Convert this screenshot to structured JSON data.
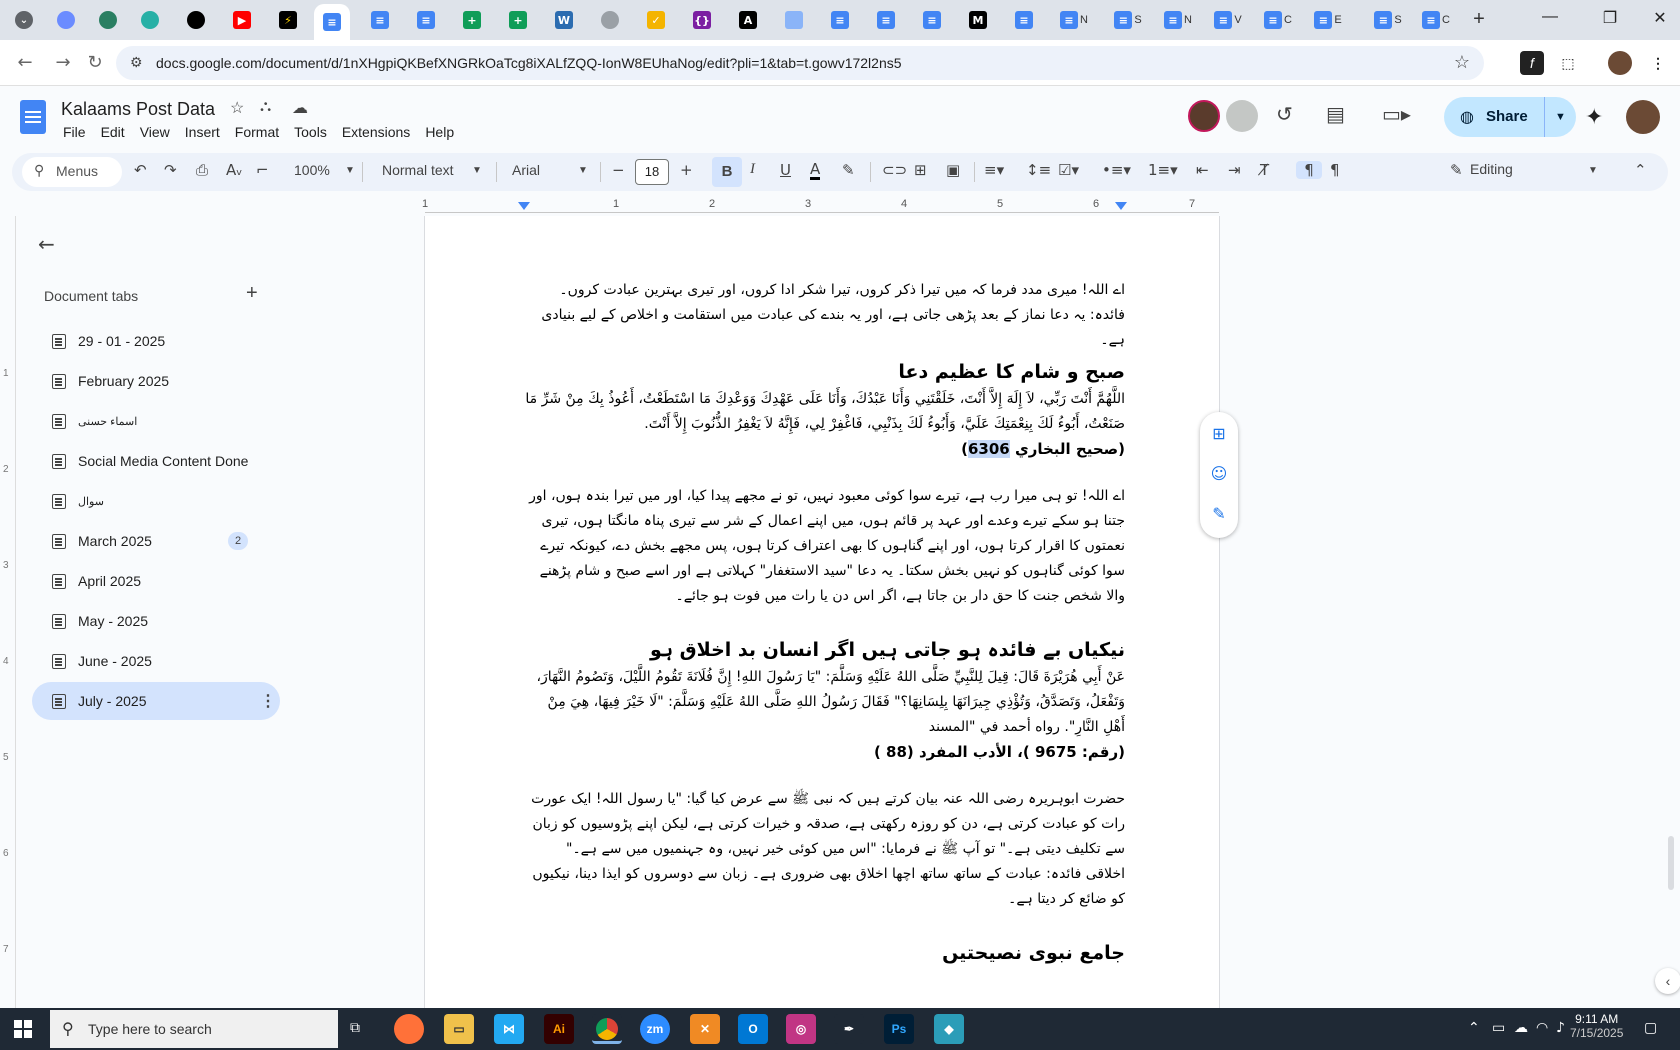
{
  "browser": {
    "url": "docs.google.com/document/d/1nXHgpiQKBefXNGRkOaTcg8iXALfZQQ-IonW8EUhaNog/edit?pli=1&tab=t.gowv172l2ns5",
    "tab_texts": [
      "N",
      "S",
      "N",
      "V",
      "C",
      "E",
      "S",
      "C"
    ],
    "new_tab": "+"
  },
  "docs": {
    "title": "Kalaams Post Data",
    "menu": [
      "File",
      "Edit",
      "View",
      "Insert",
      "Format",
      "Tools",
      "Extensions",
      "Help"
    ],
    "share_label": "Share",
    "toolbar": {
      "menus_label": "Menus",
      "zoom": "100%",
      "style": "Normal text",
      "font": "Arial",
      "font_size": "18",
      "bold": "B",
      "italic": "I",
      "underline": "U",
      "text_color": "A",
      "mode": "Editing"
    },
    "ruler_numbers": [
      "1",
      "1",
      "2",
      "3",
      "4",
      "5",
      "6",
      "7"
    ],
    "vruler_numbers": [
      "1",
      "2",
      "3",
      "4",
      "5",
      "6",
      "7"
    ]
  },
  "sidebar": {
    "heading": "Document tabs",
    "tabs": [
      {
        "label": "29 - 01 - 2025"
      },
      {
        "label": "February 2025"
      },
      {
        "label": "اسماء حسنی"
      },
      {
        "label": "Social Media Content Done"
      },
      {
        "label": "سوال"
      },
      {
        "label": "March 2025",
        "badge": "2"
      },
      {
        "label": "April 2025"
      },
      {
        "label": "May - 2025"
      },
      {
        "label": "June - 2025"
      },
      {
        "label": "July - 2025",
        "selected": true
      }
    ]
  },
  "page": {
    "p1": "اے اللہ! میری مدد فرما کہ میں تیرا ذکر کروں، تیرا شکر ادا کروں، اور تیری بہترین عبادت کروں۔ فائدہ: یہ دعا نماز کے بعد پڑھی جاتی ہے، اور یہ بندے کی عبادت میں استقامت و اخلاص کے لیے بنیادی ہے۔",
    "h1": "صبح و شام کا عظیم دعا",
    "ar1": "اللَّهُمَّ أَنْتَ رَبِّي، لاَ إِلَهَ إِلاَّ أَنْتَ، خَلَقْتَنِي وَأَنَا عَبْدُكَ، وَأَنَا عَلَى عَهْدِكَ وَوَعْدِكَ مَا اسْتَطَعْتُ، أَعُوذُ بِكَ مِنْ شَرِّ مَا صَنَعْتُ، أَبُوءُ لَكَ بِنِعْمَتِكَ عَلَيَّ، وَأَبُوءُ لَكَ بِذَنْبِي، فَاغْفِرْ لِي، فَإِنَّهُ لاَ يَغْفِرُ الذُّنُوبَ إِلاَّ أَنْتَ.",
    "ref1_pre": "(صحيح البخاري ",
    "ref1_num": "6306",
    "ref1_post": ")",
    "p2": "اے اللہ! تو ہی میرا رب ہے، تیرے سوا کوئی معبود نہیں، تو نے مجھے پیدا کیا، اور میں تیرا بندہ ہوں، اور جتنا ہو سکے تیرے وعدے اور عہد پر قائم ہوں، میں اپنے اعمال کے شر سے تیری پناہ مانگتا ہوں، تیری نعمتوں کا اقرار کرتا ہوں، اور اپنے گناہوں کا بھی اعتراف کرتا ہوں، پس مجھے بخش دے، کیونکہ تیرے سوا کوئی گناہوں کو نہیں بخش سکتا۔ یہ دعا \"سید الاستغفار\" کہلاتی ہے اور اسے صبح و شام پڑھنے والا شخص جنت کا حق دار بن جاتا ہے، اگر اس دن یا رات میں فوت ہو جائے۔",
    "h2": "نیکیاں بے فائدہ ہو جاتی ہیں اگر انسان بد اخلاق ہو",
    "ar2": "عَنْ أَبِي هُرَيْرَةَ قَالَ: قِيلَ لِلنَّبِيِّ صَلَّى اللهُ عَلَيْهِ وَسَلَّمَ: \"يَا رَسُولَ اللهِ! إِنَّ فُلَانَةَ تَقُومُ اللَّيْلَ، وَتَصُومُ النَّهَارَ، وَتَفْعَلُ، وَتَصَدَّقُ، وَتُؤْذِي جِيرَانَهَا بِلِسَانِهَا؟\" فَقَالَ رَسُولُ اللهِ صَلَّى اللهُ عَلَيْهِ وَسَلَّمَ: \"لَا خَيْرَ فِيهَا، هِيَ مِنْ أَهْلِ النَّارِ\". رواه أحمد في \"المسند",
    "ref2": "(رقم: 9675 )، الأدب المفرد (88 )",
    "p3": "حضرت ابوہریرہ رضی اللہ عنہ بیان کرتے ہیں کہ نبی ﷺ سے عرض کیا گیا: \"یا رسول اللہ! ایک عورت رات کو عبادت کرتی ہے، دن کو روزہ رکھتی ہے، صدقہ و خیرات کرتی ہے، لیکن اپنے پڑوسیوں کو زبان سے تکلیف دیتی ہے۔\" تو آپ ﷺ نے فرمایا: \"اس میں کوئی خیر نہیں، وہ جہنمیوں میں سے ہے۔\" اخلاقی فائدہ: عبادت کے ساتھ ساتھ اچھا اخلاق بھی ضروری ہے۔ زبان سے دوسروں کو ایذا دینا، نیکیوں کو ضائع کر دیتا ہے۔",
    "h3": "جامع نبوی نصیحتیں"
  },
  "taskbar": {
    "search_placeholder": "Type here to search",
    "time": "9:11 AM",
    "date": "7/15/2025",
    "apps": [
      "Ai",
      "zm",
      "Ps"
    ]
  },
  "colors": {
    "accent": "#1a73e8",
    "share_bg": "#c2e7ff",
    "selected_tab": "#d3e3fd",
    "highlight": "#c5d8f7"
  }
}
